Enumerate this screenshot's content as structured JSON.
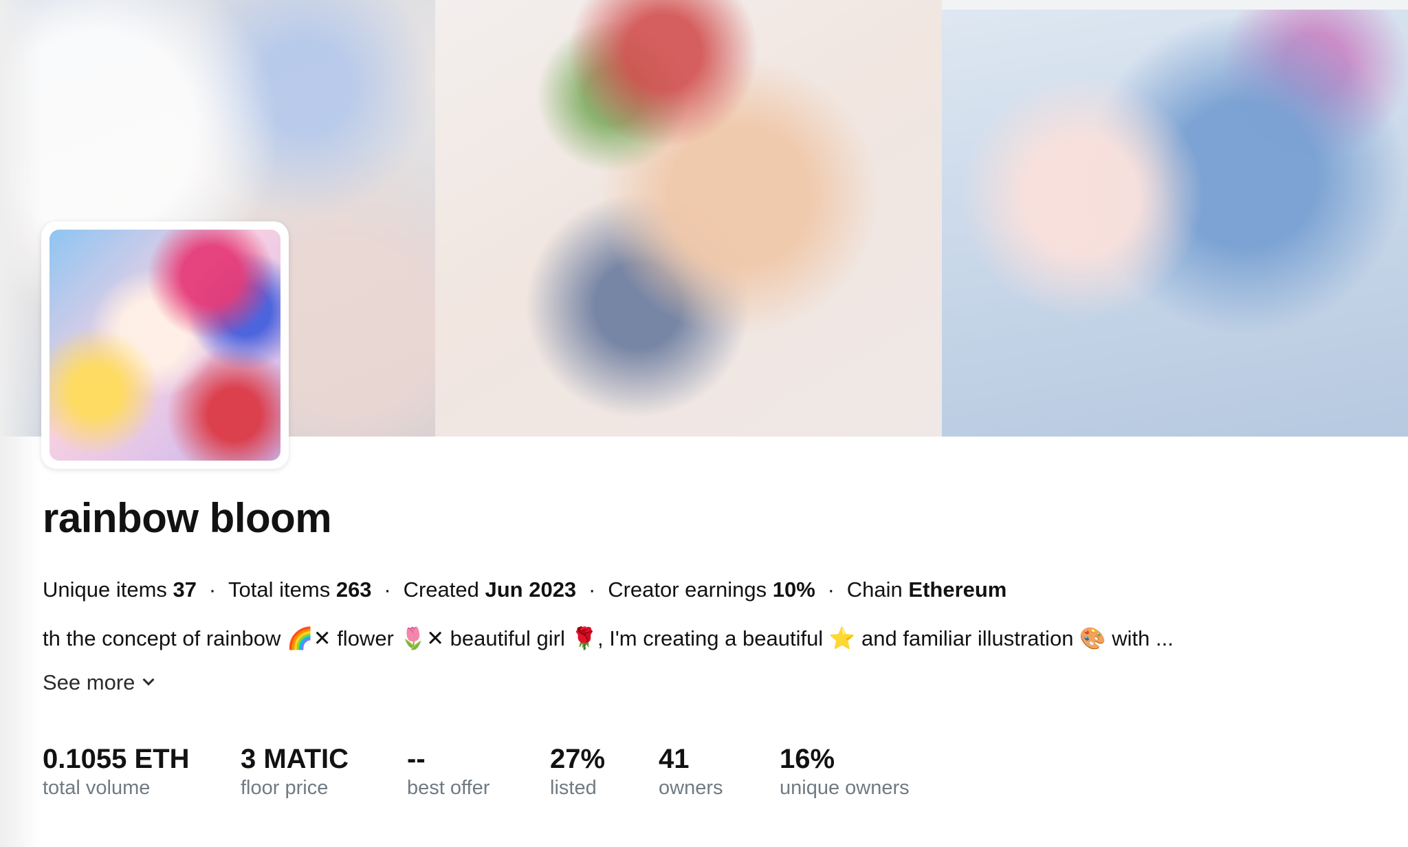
{
  "collection": {
    "name": "rainbow bloom"
  },
  "meta": {
    "unique_items_label": "Unique items",
    "unique_items_value": "37",
    "total_items_label": "Total items",
    "total_items_value": "263",
    "created_label": "Created",
    "created_value": "Jun 2023",
    "creator_earnings_label": "Creator earnings",
    "creator_earnings_value": "10%",
    "chain_label": "Chain",
    "chain_value": "Ethereum",
    "separator": "·"
  },
  "description": {
    "text": "th the concept of rainbow 🌈✕ flower 🌷✕ beautiful girl 🌹, I'm creating a beautiful ⭐ and familiar illustration 🎨 with ...",
    "see_more_label": "See more"
  },
  "stats": [
    {
      "value": "0.1055 ETH",
      "label": "total volume"
    },
    {
      "value": "3 MATIC",
      "label": "floor price"
    },
    {
      "value": "--",
      "label": "best offer"
    },
    {
      "value": "27%",
      "label": "listed"
    },
    {
      "value": "41",
      "label": "owners"
    },
    {
      "value": "16%",
      "label": "unique owners"
    }
  ]
}
